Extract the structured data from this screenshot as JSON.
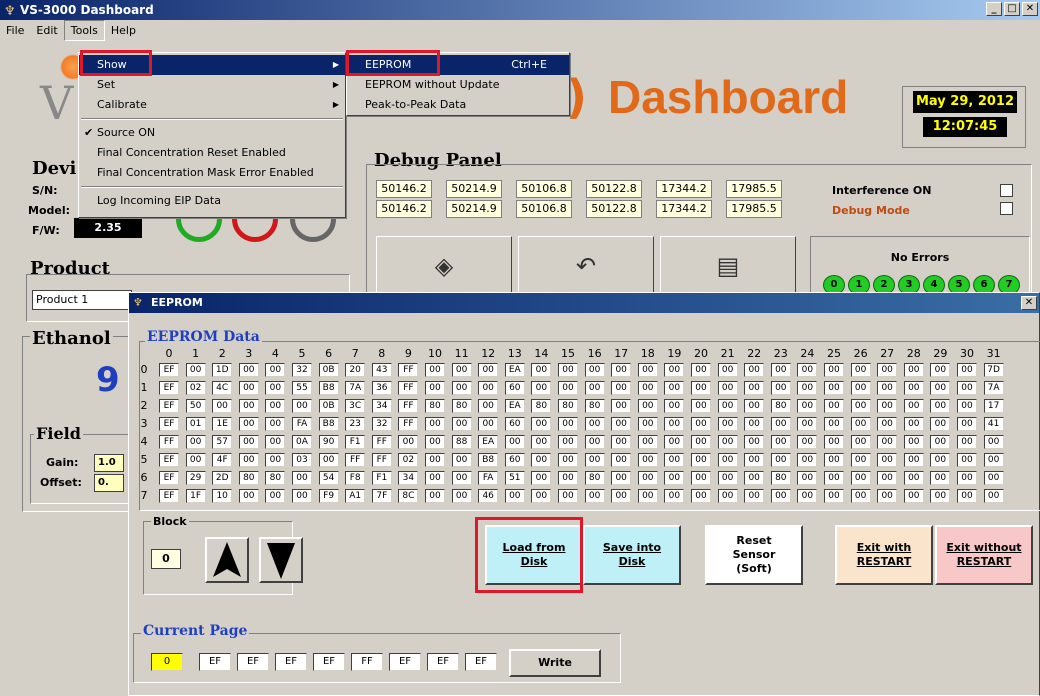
{
  "window": {
    "title": "VS-3000 Dashboard"
  },
  "menubar": [
    "File",
    "Edit",
    "Tools",
    "Help"
  ],
  "tools_menu": {
    "items": [
      {
        "label": "Show"
      },
      {
        "label": "Set"
      },
      {
        "label": "Calibrate"
      },
      {
        "label": "Source ON",
        "checked": true
      },
      {
        "label": "Final Concentration Reset Enabled"
      },
      {
        "label": "Final Concentration Mask Error Enabled"
      },
      {
        "label": "Log Incoming EIP Data"
      }
    ]
  },
  "show_menu": {
    "items": [
      {
        "label": "EEPROM",
        "accel": "Ctrl+E"
      },
      {
        "label": "EEPROM without Update"
      },
      {
        "label": "Peak-to-Peak Data"
      }
    ]
  },
  "dashboard": {
    "logo_letter": "V",
    "title": "Dashboard",
    "date": "May 29, 2012",
    "time": "12:07:45",
    "device_heading": "Devi",
    "sn_label": "S/N:",
    "model_label": "Model:",
    "fw_label": "F/W:",
    "fw_value": "2.35",
    "debug_heading": "Debug Panel",
    "debug_row1": [
      "50146.2",
      "50214.9",
      "50106.8",
      "50122.8",
      "17344.2",
      "17985.5"
    ],
    "debug_row2": [
      "50146.2",
      "50214.9",
      "50106.8",
      "50122.8",
      "17344.2",
      "17985.5"
    ],
    "interference_label": "Interference ON",
    "debug_mode_label": "Debug Mode",
    "no_errors_label": "No Errors",
    "leds": [
      "0",
      "1",
      "2",
      "3",
      "4",
      "5",
      "6",
      "7"
    ],
    "product_heading": "Product",
    "product_value": "Product 1",
    "ethanol_heading": "Ethanol",
    "ethanol_value": "9",
    "field_heading": "Field",
    "gain_label": "Gain:",
    "gain_value": "1.0",
    "offset_label": "Offset:",
    "offset_value": "0."
  },
  "eeprom": {
    "title": "EEPROM",
    "data_heading": "EEPROM Data",
    "columns": [
      "0",
      "1",
      "2",
      "3",
      "4",
      "5",
      "6",
      "7",
      "8",
      "9",
      "10",
      "11",
      "12",
      "13",
      "14",
      "15",
      "16",
      "17",
      "18",
      "19",
      "20",
      "21",
      "22",
      "23",
      "24",
      "25",
      "26",
      "27",
      "28",
      "29",
      "30",
      "31"
    ],
    "rows": [
      [
        "EF",
        "00",
        "1D",
        "00",
        "00",
        "32",
        "0B",
        "20",
        "43",
        "FF",
        "00",
        "00",
        "00",
        "EA",
        "00",
        "00",
        "00",
        "00",
        "00",
        "00",
        "00",
        "00",
        "00",
        "00",
        "00",
        "00",
        "00",
        "00",
        "00",
        "00",
        "00",
        "7D"
      ],
      [
        "EF",
        "02",
        "4C",
        "00",
        "00",
        "55",
        "B8",
        "7A",
        "36",
        "FF",
        "00",
        "00",
        "00",
        "60",
        "00",
        "00",
        "00",
        "00",
        "00",
        "00",
        "00",
        "00",
        "00",
        "00",
        "00",
        "00",
        "00",
        "00",
        "00",
        "00",
        "00",
        "7A"
      ],
      [
        "EF",
        "50",
        "00",
        "00",
        "00",
        "00",
        "0B",
        "3C",
        "34",
        "FF",
        "80",
        "80",
        "00",
        "EA",
        "80",
        "80",
        "80",
        "00",
        "00",
        "00",
        "00",
        "00",
        "00",
        "80",
        "00",
        "00",
        "00",
        "00",
        "00",
        "00",
        "00",
        "17"
      ],
      [
        "EF",
        "01",
        "1E",
        "00",
        "00",
        "FA",
        "B8",
        "23",
        "32",
        "FF",
        "00",
        "00",
        "00",
        "60",
        "00",
        "00",
        "00",
        "00",
        "00",
        "00",
        "00",
        "00",
        "00",
        "00",
        "00",
        "00",
        "00",
        "00",
        "00",
        "00",
        "00",
        "41"
      ],
      [
        "FF",
        "00",
        "57",
        "00",
        "00",
        "0A",
        "90",
        "F1",
        "FF",
        "00",
        "00",
        "88",
        "EA",
        "00",
        "00",
        "00",
        "00",
        "00",
        "00",
        "00",
        "00",
        "00",
        "00",
        "00",
        "00",
        "00",
        "00",
        "00",
        "00",
        "00",
        "00",
        "00"
      ],
      [
        "EF",
        "00",
        "4F",
        "00",
        "00",
        "03",
        "00",
        "FF",
        "FF",
        "02",
        "00",
        "00",
        "B8",
        "60",
        "00",
        "00",
        "00",
        "00",
        "00",
        "00",
        "00",
        "00",
        "00",
        "00",
        "00",
        "00",
        "00",
        "00",
        "00",
        "00",
        "00",
        "00"
      ],
      [
        "EF",
        "29",
        "2D",
        "80",
        "80",
        "00",
        "54",
        "F8",
        "F1",
        "34",
        "00",
        "00",
        "FA",
        "51",
        "00",
        "00",
        "80",
        "00",
        "00",
        "00",
        "00",
        "00",
        "00",
        "80",
        "00",
        "00",
        "00",
        "00",
        "00",
        "00",
        "00",
        "00"
      ],
      [
        "EF",
        "1F",
        "10",
        "00",
        "00",
        "00",
        "F9",
        "A1",
        "7F",
        "8C",
        "00",
        "00",
        "46",
        "00",
        "00",
        "00",
        "00",
        "00",
        "00",
        "00",
        "00",
        "00",
        "00",
        "00",
        "00",
        "00",
        "00",
        "00",
        "00",
        "00",
        "00",
        "00"
      ]
    ],
    "block_heading": "Block",
    "block_value": "0",
    "buttons": {
      "load": "Load from\nDisk",
      "save": "Save into\nDisk",
      "reset": "Reset\nSensor\n(Soft)",
      "exit_restart": "Exit with\nRESTART",
      "exit_no_restart": "Exit without\nRESTART"
    },
    "current_page_heading": "Current Page",
    "page_index": "0",
    "page_values": [
      "EF",
      "EF",
      "EF",
      "EF",
      "FF",
      "EF",
      "EF",
      "EF"
    ],
    "write_label": "Write"
  },
  "colors": {
    "accent": "#e06a1a",
    "highlight_box": "#e0162b",
    "menu_highlight": "#0a246a",
    "load_btn": "#bff0f8",
    "exit_restart": "#fbe4cc",
    "exit_no_restart": "#f8c8c8"
  }
}
